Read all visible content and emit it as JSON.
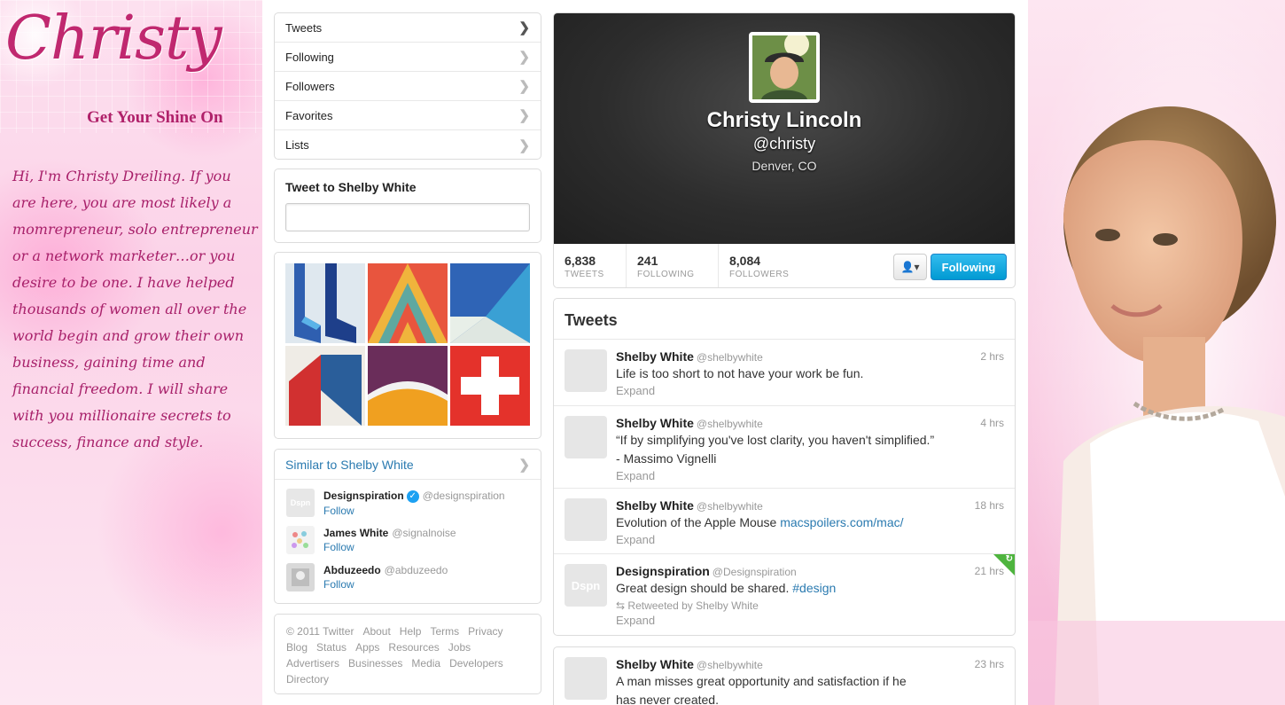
{
  "brand": {
    "logo_text": "Christy",
    "tagline": "Get Your Shine On",
    "bio": "Hi, I'm Christy Dreiling. If you are here, you are most likely a momrepreneur, solo entrepreneur or a network marketer…or you desire to be one.  I have helped thousands of women all over the world begin and grow their own business, gaining time and financial freedom.  I will share with you millionaire secrets to success, finance and style."
  },
  "nav": {
    "items": [
      {
        "label": "Tweets",
        "icon": "chevron-right-icon"
      },
      {
        "label": "Following",
        "icon": "chevron-right-icon"
      },
      {
        "label": "Followers",
        "icon": "chevron-right-icon"
      },
      {
        "label": "Favorites",
        "icon": "chevron-right-icon"
      },
      {
        "label": "Lists",
        "icon": "chevron-right-icon"
      }
    ]
  },
  "tweet_to": {
    "title": "Tweet to Shelby White",
    "value": ""
  },
  "similar": {
    "title": "Similar to Shelby White",
    "users": [
      {
        "name": "Designspiration",
        "handle": "@designspiration",
        "follow": "Follow",
        "avatar_text": "Dspn"
      },
      {
        "name": "James White",
        "handle": "@signalnoise",
        "follow": "Follow",
        "avatar_text": ""
      },
      {
        "name": "Abduzeedo",
        "handle": "@abduzeedo",
        "follow": "Follow",
        "avatar_text": ""
      }
    ]
  },
  "footer": {
    "links": [
      "© 2011 Twitter",
      "About",
      "Help",
      "Terms",
      "Privacy",
      "Blog",
      "Status",
      "Apps",
      "Resources",
      "Jobs",
      "Advertisers",
      "Businesses",
      "Media",
      "Developers",
      "Directory"
    ]
  },
  "profile": {
    "name": "Christy Lincoln",
    "handle": "@christy",
    "location": "Denver, CO",
    "stats": [
      {
        "num": "6,838",
        "label": "TWEETS"
      },
      {
        "num": "241",
        "label": "FOLLOWING"
      },
      {
        "num": "8,084",
        "label": "FOLLOWERS"
      }
    ],
    "follow_button": "Following",
    "user_menu_icon": "user-dropdown-icon"
  },
  "stream": {
    "title": "Tweets",
    "tweets": [
      {
        "name": "Shelby White",
        "handle": "@shelbywhite",
        "time": "2 hrs",
        "text": "Life is too short to not have your work be fun.",
        "expand": "Expand"
      },
      {
        "name": "Shelby White",
        "handle": "@shelbywhite",
        "time": "4 hrs",
        "text": "“If by simplifying you've lost clarity, you haven't simplified.”",
        "text2": "- Massimo Vignelli",
        "expand": "Expand"
      },
      {
        "name": "Shelby White",
        "handle": "@shelbywhite",
        "time": "18 hrs",
        "text": "Evolution of the Apple Mouse ",
        "link": "macspoilers.com/mac/",
        "expand": "Expand"
      },
      {
        "name": "Designspiration",
        "handle": "@Designspiration",
        "time": "21 hrs",
        "text": "Great design should be shared. ",
        "link": "#design",
        "retweet": "Retweeted by Shelby White",
        "expand": "Expand",
        "avatar_text": "Dspn"
      }
    ],
    "tweet5": {
      "name": "Shelby White",
      "handle": "@shelbywhite",
      "time": "23 hrs",
      "text": "A man misses great opportunity and satisfaction if he",
      "text2": "has never created."
    }
  },
  "colors": {
    "accent": "#2a7ab0",
    "follow_button": "#019ad2",
    "brand_pink": "#c0286f",
    "retweet_green": "#4eb43e"
  }
}
